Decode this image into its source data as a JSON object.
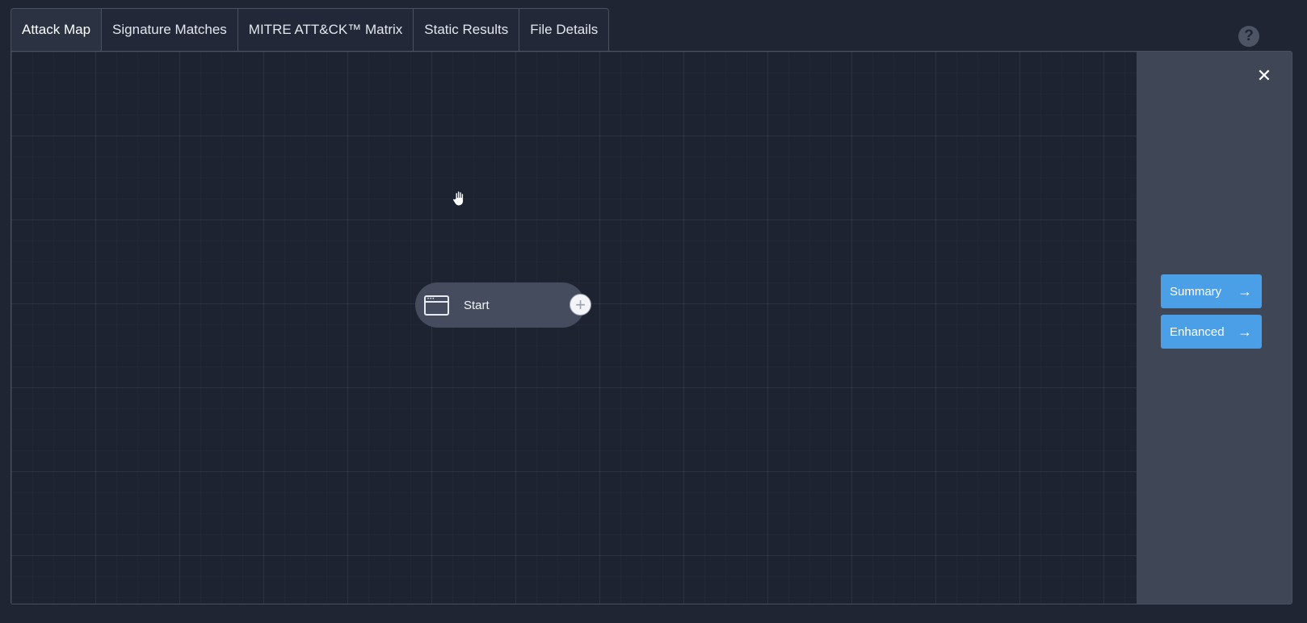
{
  "tabs": [
    {
      "label": "Attack Map",
      "active": true
    },
    {
      "label": "Signature Matches",
      "active": false
    },
    {
      "label": "MITRE ATT&CK™ Matrix",
      "active": false
    },
    {
      "label": "Static Results",
      "active": false
    },
    {
      "label": "File Details",
      "active": false
    }
  ],
  "help": {
    "icon": "question-icon",
    "glyph": "?"
  },
  "canvas": {
    "start_node": {
      "label": "Start",
      "icon": "window-icon",
      "add_icon": "plus-icon",
      "add_glyph": "+"
    },
    "cursor_icon": "hand-cursor-icon"
  },
  "sidebar": {
    "close_glyph": "✕",
    "buttons": [
      {
        "label": "Summary",
        "arrow": "→"
      },
      {
        "label": "Enhanced",
        "arrow": "→"
      }
    ]
  },
  "colors": {
    "background": "#1f2532",
    "canvas": "#1d2331",
    "sidebar": "#3f4656",
    "node": "#454c5d",
    "accent": "#4a9fe6"
  }
}
